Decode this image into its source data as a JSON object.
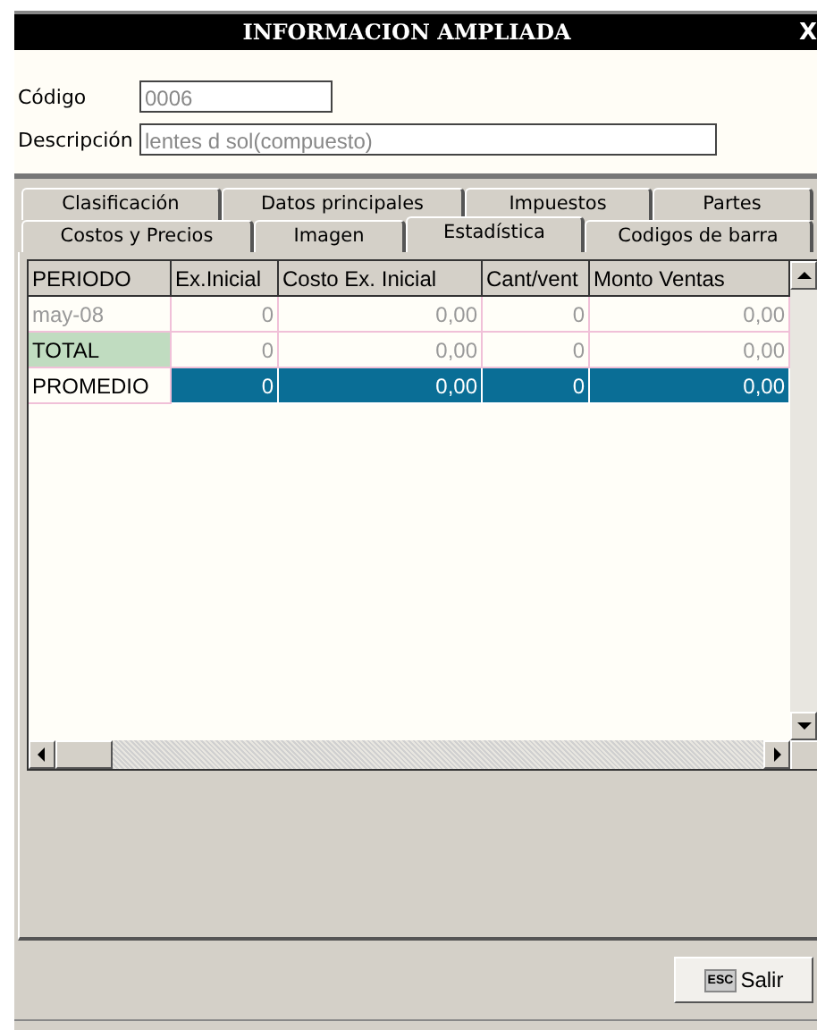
{
  "window": {
    "title": "INFORMACION AMPLIADA",
    "close": "X"
  },
  "form": {
    "fields": [
      {
        "label": "Código",
        "value": "0006"
      },
      {
        "label": "Descripción",
        "value": "lentes d sol(compuesto)"
      }
    ]
  },
  "tabs": [
    [
      {
        "label": "Clasificación",
        "selected": false
      },
      {
        "label": "Datos principales",
        "selected": false
      },
      {
        "label": "Impuestos",
        "selected": false
      },
      {
        "label": "Partes",
        "selected": false
      }
    ],
    [
      {
        "label": "Costos y Precios",
        "selected": false
      },
      {
        "label": "Imagen",
        "selected": false
      },
      {
        "label": "Estadística",
        "selected": true
      },
      {
        "label": "Codigos de barra",
        "selected": false
      }
    ]
  ],
  "table": {
    "columns": [
      "PERIODO",
      "Ex.Inicial",
      "Costo Ex. Inicial",
      "Cant/vent",
      "Monto Ventas"
    ],
    "rows": [
      {
        "kind": "period",
        "selected": false,
        "cells": [
          "may-08",
          "0",
          "0,00",
          "0",
          "0,00"
        ]
      },
      {
        "kind": "total",
        "selected": false,
        "cells": [
          "TOTAL",
          "0",
          "0,00",
          "0",
          "0,00"
        ]
      },
      {
        "kind": "average",
        "selected": true,
        "cells": [
          "PROMEDIO",
          "0",
          "0,00",
          "0",
          "0,00"
        ]
      }
    ]
  },
  "buttons": [
    {
      "key": "ESC",
      "label": "Salir"
    }
  ]
}
